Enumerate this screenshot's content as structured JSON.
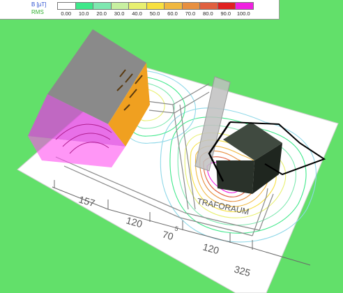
{
  "legend": {
    "quantity": "B [µT]",
    "mode": "RMS",
    "ticks": [
      "0.00",
      "10.0",
      "20.0",
      "30.0",
      "40.0",
      "50.0",
      "60.0",
      "70.0",
      "80.0",
      "90.0",
      "100.0"
    ],
    "colors": [
      "#ffffff",
      "#3ee88a",
      "#7ee8b0",
      "#c8f0a0",
      "#e8f070",
      "#f8e040",
      "#f0b840",
      "#e89040",
      "#e06040",
      "#e02020",
      "#f020e0"
    ]
  },
  "drawing": {
    "room_label": "TRAFORAUM",
    "dimensions": [
      "157",
      "120",
      "70",
      "5",
      "120",
      "325"
    ]
  },
  "scene": {
    "floor_color": "#ffffff",
    "cabinet_color": "#f0a020",
    "transformer_color": "#303830",
    "highlight_color": "#e040e0"
  }
}
